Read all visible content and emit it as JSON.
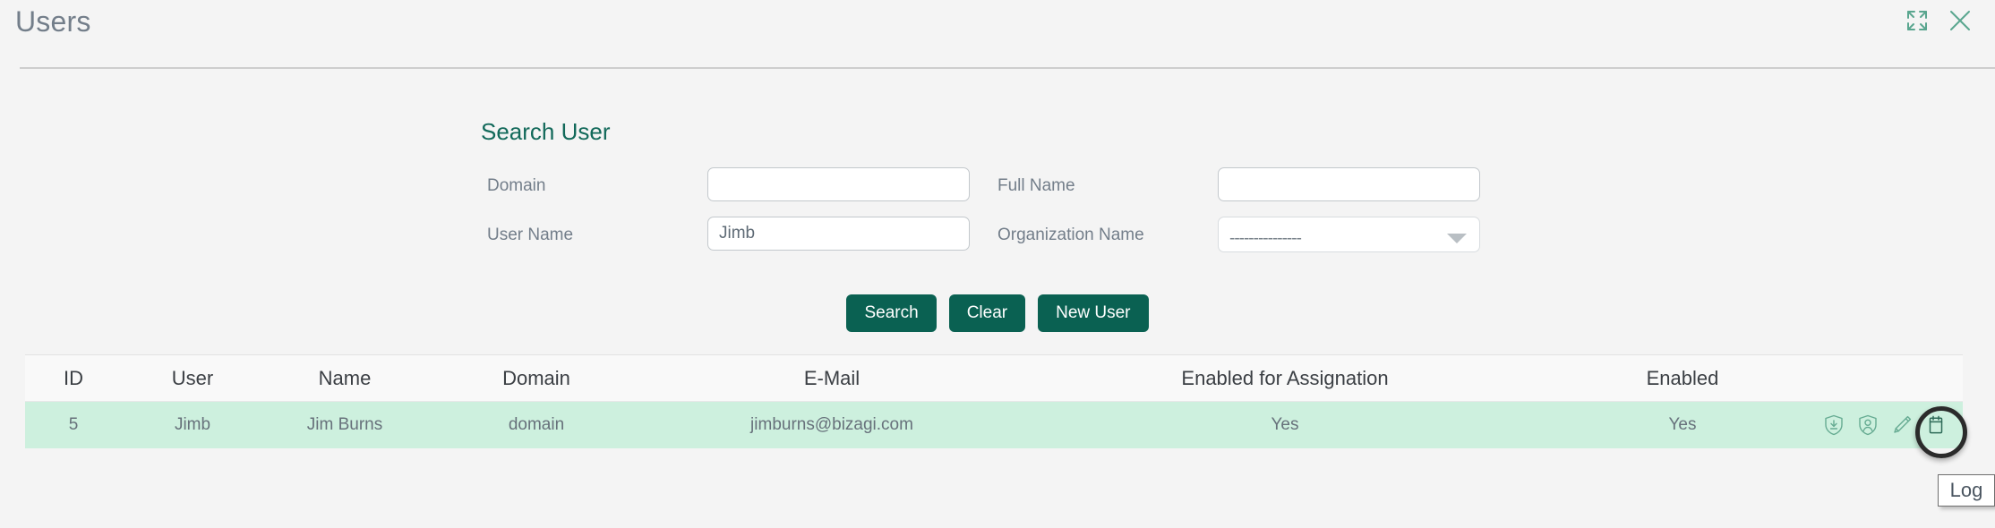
{
  "window": {
    "title": "Users",
    "actions": [
      {
        "name": "expand-icon",
        "label": "Expand"
      },
      {
        "name": "close-icon",
        "label": "Close"
      }
    ]
  },
  "search_panel": {
    "title": "Search User",
    "fields": {
      "domain": {
        "label": "Domain",
        "value": "",
        "placeholder": ""
      },
      "user_name": {
        "label": "User Name",
        "value": "Jimb",
        "placeholder": ""
      },
      "full_name": {
        "label": "Full Name",
        "value": "",
        "placeholder": ""
      },
      "organization_name": {
        "label": "Organization Name",
        "value": "---------------"
      }
    },
    "buttons": {
      "search": "Search",
      "clear": "Clear",
      "new_user": "New User"
    }
  },
  "results_table": {
    "columns": [
      "ID",
      "User",
      "Name",
      "Domain",
      "E-Mail",
      "Enabled for Assignation",
      "Enabled"
    ],
    "rows": [
      {
        "id": "5",
        "user": "Jimb",
        "name": "Jim Burns",
        "domain": "domain",
        "email": "jimburns@bizagi.com",
        "enabled_for_assignation": "Yes",
        "enabled": "Yes",
        "selected": true,
        "actions": [
          {
            "name": "shield-download-icon",
            "label": "Import"
          },
          {
            "name": "shield-user-icon",
            "label": "Roles"
          },
          {
            "name": "pencil-icon",
            "label": "Edit"
          },
          {
            "name": "clipboard-log-icon",
            "label": "Log"
          }
        ]
      }
    ]
  },
  "tooltip": {
    "text": "Log"
  },
  "colors": {
    "accent": "#0a6152",
    "panel_title": "#12695a",
    "row_selected": "#cdf0de",
    "page_bg": "#f4f4f4",
    "header_text": "#737e8a",
    "icon_green": "#5aa68f"
  }
}
